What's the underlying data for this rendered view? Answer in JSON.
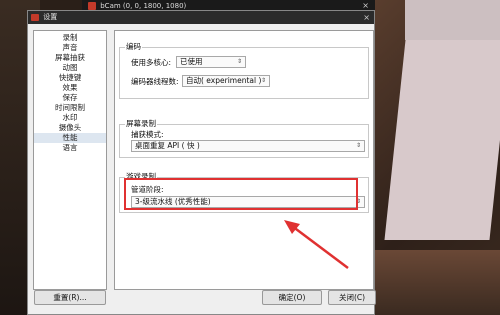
{
  "background_app": {
    "title": "bCam (0, 0, 1800, 1080)",
    "close_glyph": "×"
  },
  "dialog": {
    "title": "设置",
    "close_glyph": "×"
  },
  "sidebar": {
    "items": [
      {
        "label": "录制"
      },
      {
        "label": "声音"
      },
      {
        "label": "屏幕抽获"
      },
      {
        "label": "动图"
      },
      {
        "label": "快捷键"
      },
      {
        "label": "效果"
      },
      {
        "label": "保存"
      },
      {
        "label": "时间限制"
      },
      {
        "label": "水印"
      },
      {
        "label": "摄像头"
      },
      {
        "label": "性能"
      },
      {
        "label": "语言"
      }
    ],
    "active_index": 10
  },
  "encode_group": {
    "title": "编码",
    "multicore_label": "使用多核心:",
    "multicore_value": "已使用",
    "threads_label": "编码器线程数:",
    "threads_value": "自动( experimental )"
  },
  "screen_group": {
    "title": "屏幕录制",
    "capture_mode_label": "捕获模式:",
    "capture_mode_value": "桌面重复 API ( 快 )"
  },
  "game_group": {
    "title": "游戏录制",
    "pipeline_label": "管道阶段:",
    "pipeline_value": "3-级流水线 (优秀性能)"
  },
  "buttons": {
    "reset": "重置(R)...",
    "ok": "确定(O)",
    "close": "关闭(C)"
  },
  "annotation_color": "#e03131"
}
